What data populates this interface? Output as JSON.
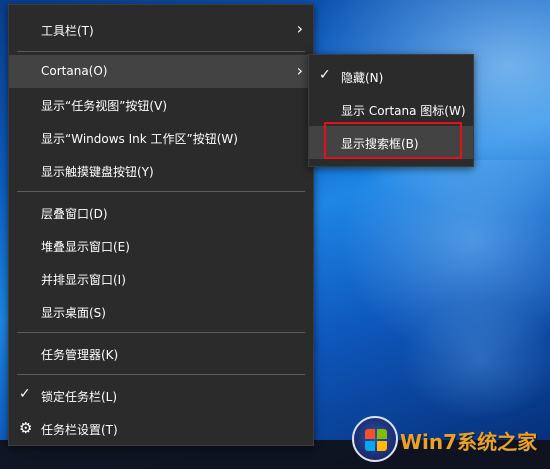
{
  "main_menu": {
    "items": [
      {
        "label": "工具栏(T)",
        "has_submenu": true
      },
      {
        "label": "Cortana(O)",
        "has_submenu": true,
        "state": "hover"
      },
      {
        "label": "显示“任务视图”按钮(V)"
      },
      {
        "label": "显示“Windows Ink 工作区”按钮(W)"
      },
      {
        "label": "显示触摸键盘按钮(Y)"
      },
      {
        "label": "层叠窗口(D)"
      },
      {
        "label": "堆叠显示窗口(E)"
      },
      {
        "label": "并排显示窗口(I)"
      },
      {
        "label": "显示桌面(S)"
      },
      {
        "label": "任务管理器(K)"
      },
      {
        "label": "锁定任务栏(L)",
        "checked": true
      },
      {
        "label": "任务栏设置(T)",
        "icon": "gear-icon"
      }
    ]
  },
  "cortana_submenu": {
    "items": [
      {
        "label": "隐藏(N)",
        "checked": true
      },
      {
        "label": "显示 Cortana 图标(W)"
      },
      {
        "label": "显示搜索框(B)",
        "state": "hover",
        "highlighted": true
      }
    ]
  },
  "glyphs": {
    "chevron": "›",
    "check": "✓",
    "gear": "⚙"
  },
  "watermark": {
    "text_part1": "Win7",
    "text_part2": "系统之家",
    "logo": "windows-logo-icon"
  },
  "colors": {
    "menu_bg": "#2b2b2b",
    "menu_hover": "#434343",
    "highlight_border": "#e4101e",
    "watermark_accent": "#f0a020"
  }
}
